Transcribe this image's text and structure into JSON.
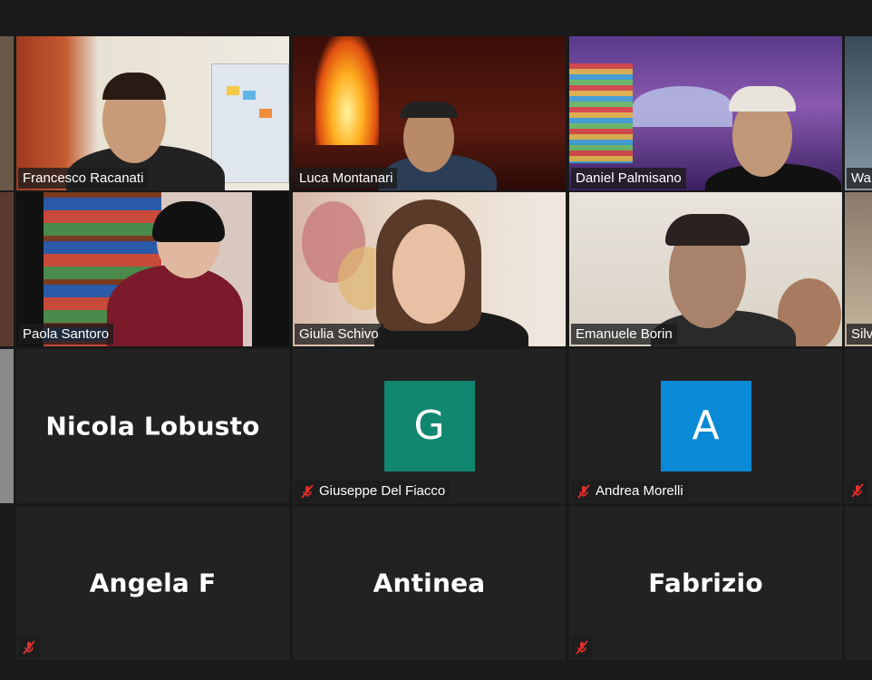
{
  "participants": [
    {
      "name": "Francesco Racanati",
      "type": "video"
    },
    {
      "name": "Luca Montanari",
      "type": "video"
    },
    {
      "name": "Daniel Palmisano",
      "type": "video"
    },
    {
      "name": "Wa",
      "type": "video"
    },
    {
      "name": "Paola Santoro",
      "type": "video"
    },
    {
      "name": "Giulia Schivo",
      "type": "video"
    },
    {
      "name": "Emanuele Borin",
      "type": "video"
    },
    {
      "name": "Silv",
      "type": "video"
    },
    {
      "name": "Nicola Lobusto",
      "type": "name-only"
    },
    {
      "name": "Giuseppe Del Fiacco",
      "type": "avatar",
      "initial": "G",
      "avatar_color": "#12876f",
      "muted": true
    },
    {
      "name": "Andrea Morelli",
      "type": "avatar",
      "initial": "A",
      "avatar_color": "#0a8ad6",
      "muted": true
    },
    {
      "name": "Angela F",
      "type": "name-only",
      "muted": true
    },
    {
      "name": "Antinea",
      "type": "name-only"
    },
    {
      "name": "Fabrizio",
      "type": "name-only",
      "muted": true
    }
  ],
  "colors": {
    "active_speaker_border": "#c8d96b",
    "muted_icon": "#e0312c",
    "tile_background": "#222222"
  }
}
